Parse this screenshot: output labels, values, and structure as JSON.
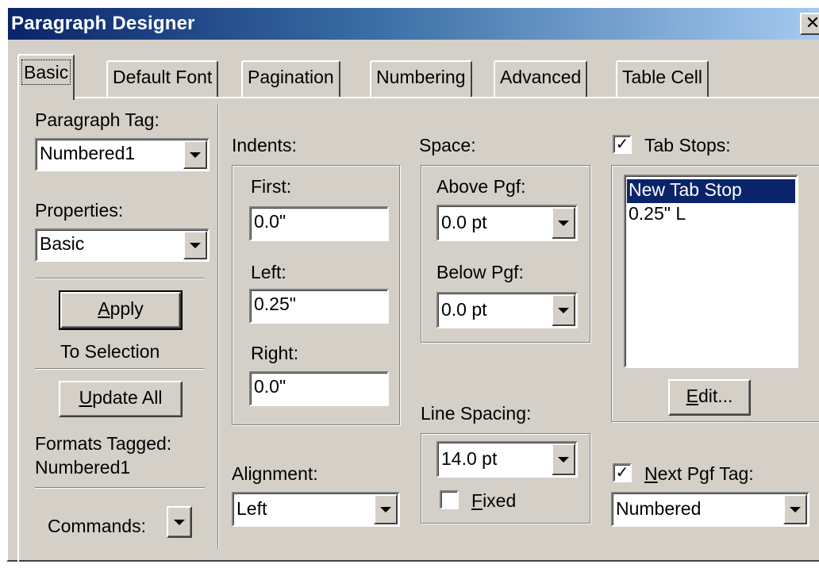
{
  "window": {
    "title": "Paragraph Designer",
    "close_glyph": "✕"
  },
  "tabs": [
    {
      "label": "Basic",
      "active": true
    },
    {
      "label": "Default Font",
      "active": false
    },
    {
      "label": "Pagination",
      "active": false
    },
    {
      "label": "Numbering",
      "active": false
    },
    {
      "label": "Advanced",
      "active": false
    },
    {
      "label": "Table Cell",
      "active": false
    }
  ],
  "left": {
    "paragraph_tag_label": "Paragraph Tag:",
    "paragraph_tag_value": "Numbered1",
    "properties_label": "Properties:",
    "properties_value": "Basic",
    "apply_button": {
      "pre": "",
      "mnemonic": "A",
      "post": "pply"
    },
    "to_selection": "To Selection",
    "update_all_button": {
      "pre": "",
      "mnemonic": "U",
      "post": "pdate All"
    },
    "formats_tagged_label": "Formats Tagged:",
    "formats_tagged_value": "Numbered1",
    "commands_label": "Commands:"
  },
  "indents": {
    "label": "Indents:",
    "first_label": "First:",
    "first_value": "0.0\"",
    "left_label": "Left:",
    "left_value": "0.25\"",
    "right_label": "Right:",
    "right_value": "0.0\""
  },
  "alignment": {
    "label": "Alignment:",
    "value": "Left"
  },
  "space": {
    "label": "Space:",
    "above_label": "Above Pgf:",
    "above_value": "0.0 pt",
    "below_label": "Below Pgf:",
    "below_value": "0.0 pt"
  },
  "line_spacing": {
    "label": "Line Spacing:",
    "value": "14.0 pt",
    "fixed": {
      "pre": "",
      "mnemonic": "F",
      "post": "ixed",
      "checked": false
    }
  },
  "tab_stops": {
    "label": "Tab Stops:",
    "checked": true,
    "check_glyph": "✓",
    "items": [
      "New Tab Stop",
      "0.25\"  L"
    ],
    "selected_index": 0,
    "edit_button": {
      "pre": "",
      "mnemonic": "E",
      "post": "dit..."
    }
  },
  "next_pgf_tag": {
    "label": {
      "pre": "",
      "mnemonic": "N",
      "post": "ext Pgf Tag:"
    },
    "checked": true,
    "check_glyph": "✓",
    "value": "Numbered"
  },
  "colors": {
    "title_bar": "#0a246a",
    "dialog_face": "#d4d0c8",
    "selection": "#0a246a"
  }
}
